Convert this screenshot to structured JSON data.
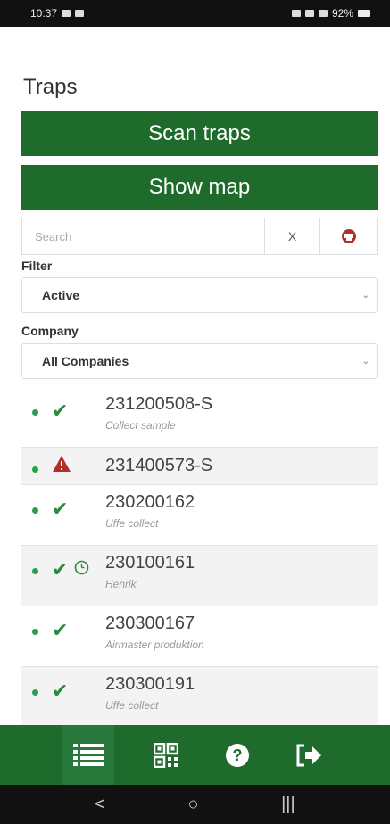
{
  "status": {
    "time": "10:37",
    "battery": "92%"
  },
  "page": {
    "title": "Traps"
  },
  "actions": {
    "scan_label": "Scan traps",
    "map_label": "Show map"
  },
  "search": {
    "placeholder": "Search",
    "clear_label": "X"
  },
  "filter": {
    "label": "Filter",
    "value": "Active"
  },
  "company": {
    "label": "Company",
    "value": "All Companies"
  },
  "traps": [
    {
      "id": "231200508-S",
      "sub": "Collect sample",
      "status": "ok",
      "extra": ""
    },
    {
      "id": "231400573-S",
      "sub": "",
      "status": "warning",
      "extra": ""
    },
    {
      "id": "230200162",
      "sub": "Uffe collect",
      "status": "ok",
      "extra": ""
    },
    {
      "id": "230100161",
      "sub": "Henrik",
      "status": "ok",
      "extra": "clock"
    },
    {
      "id": "230300167",
      "sub": "Airmaster produktion",
      "status": "ok",
      "extra": ""
    },
    {
      "id": "230300191",
      "sub": "Uffe collect",
      "status": "ok",
      "extra": ""
    }
  ],
  "colors": {
    "brand_green": "#1e6b2b",
    "status_dot": "#27a04a",
    "warning_red": "#b0302a"
  },
  "bottom_nav": [
    "list-icon",
    "qr-code-icon",
    "help-icon",
    "logout-icon"
  ],
  "system_nav": {
    "back": "<",
    "home": "○",
    "recents": "|||"
  }
}
